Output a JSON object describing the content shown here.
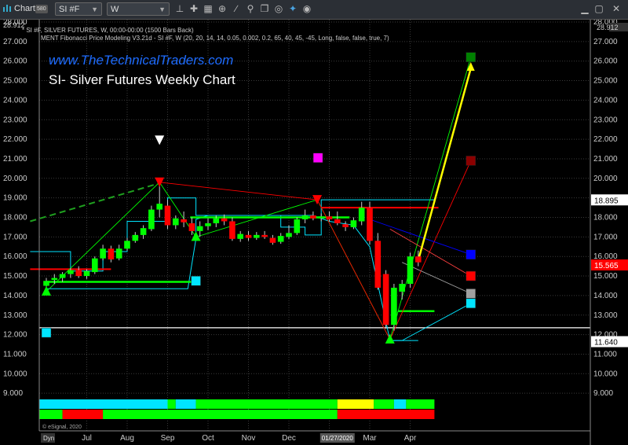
{
  "toolbar": {
    "app_label": "Chart",
    "app_badge": "580",
    "symbol": "SI #F",
    "interval": "W",
    "icons": [
      "pin-icon",
      "crosshair-icon",
      "grid-icon",
      "zoom-icon",
      "trend-icon",
      "link-icon",
      "copy-icon",
      "globe-icon",
      "twitter-icon",
      "eye-icon"
    ]
  },
  "header": {
    "line1": "* SI #F, SILVER FUTURES, W, 00:00-00:00 (1500 Bars Back)",
    "line2": "MENT Fibonacci Price Modeling V3.21d - SI #F, W (20, 20, 14, 14, 0.05, 0.002, 0.2, 65, 40, 45, -45, Long, false, false, true, 7)",
    "corner_left": "28.912",
    "corner_right": "28.912"
  },
  "overlay": {
    "website": "www.TheTechnicalTraders.com",
    "title": "SI- Silver Futures Weekly Chart"
  },
  "footer": {
    "copyright": "© eSignal, 2020",
    "dyn": "Dyn"
  },
  "colors": {
    "up": "#00ff00",
    "down": "#ff0000",
    "cyan": "#00e5ff",
    "yellow": "#ffff00",
    "blue": "#0000ff",
    "magenta": "#ff00ff",
    "green_target": "#008000",
    "darkred_target": "#8b0000",
    "gray": "#a0a0a0",
    "white": "#ffffff",
    "grid": "#3a3a3a",
    "axis_text": "#cccccc"
  },
  "chart_data": {
    "type": "candlestick",
    "ylim": [
      8.5,
      29.1
    ],
    "y_ticks": [
      "9.000",
      "10.000",
      "11.000",
      "12.000",
      "13.000",
      "14.000",
      "15.000",
      "16.000",
      "17.000",
      "18.000",
      "19.000",
      "20.000",
      "21.000",
      "22.000",
      "23.000",
      "24.000",
      "25.000",
      "26.000",
      "27.000",
      "28.000"
    ],
    "x_labels": [
      "Jul",
      "Aug",
      "Sep",
      "Oct",
      "Nov",
      "Dec",
      "2020",
      "Mar",
      "Apr"
    ],
    "x_label_weeks": [
      5,
      10,
      15,
      20,
      25,
      30,
      35,
      40,
      45
    ],
    "x_current_date": "01/27/2020",
    "price_labels": [
      {
        "value": 18.895,
        "text": "18.895",
        "color": "#ffffff",
        "text_color": "#000000"
      },
      {
        "value": 15.565,
        "text": "15.565",
        "color": "#ff0000",
        "text_color": "#ffffff"
      },
      {
        "value": 11.64,
        "text": "11.640",
        "color": "#ffffff",
        "text_color": "#000000"
      }
    ],
    "candles": [
      {
        "o": 14.5,
        "h": 14.9,
        "l": 14.2,
        "c": 14.75
      },
      {
        "o": 14.8,
        "h": 15.1,
        "l": 14.6,
        "c": 14.9
      },
      {
        "o": 14.9,
        "h": 15.2,
        "l": 14.7,
        "c": 15.1
      },
      {
        "o": 15.1,
        "h": 15.4,
        "l": 14.9,
        "c": 15.3
      },
      {
        "o": 15.3,
        "h": 15.5,
        "l": 14.9,
        "c": 15.0
      },
      {
        "o": 15.0,
        "h": 15.35,
        "l": 14.85,
        "c": 15.25
      },
      {
        "o": 15.2,
        "h": 16.0,
        "l": 15.1,
        "c": 15.9
      },
      {
        "o": 15.9,
        "h": 16.6,
        "l": 15.8,
        "c": 16.4
      },
      {
        "o": 16.4,
        "h": 16.55,
        "l": 15.7,
        "c": 15.85
      },
      {
        "o": 15.9,
        "h": 16.6,
        "l": 15.8,
        "c": 16.4
      },
      {
        "o": 16.4,
        "h": 16.95,
        "l": 16.3,
        "c": 16.8
      },
      {
        "o": 16.8,
        "h": 17.25,
        "l": 16.7,
        "c": 17.1
      },
      {
        "o": 17.1,
        "h": 17.6,
        "l": 16.9,
        "c": 17.45
      },
      {
        "o": 17.4,
        "h": 18.6,
        "l": 17.3,
        "c": 18.4
      },
      {
        "o": 18.4,
        "h": 19.8,
        "l": 18.0,
        "c": 18.7
      },
      {
        "o": 18.6,
        "h": 18.9,
        "l": 17.4,
        "c": 17.6
      },
      {
        "o": 17.6,
        "h": 18.1,
        "l": 17.4,
        "c": 17.95
      },
      {
        "o": 17.9,
        "h": 18.3,
        "l": 17.5,
        "c": 17.75
      },
      {
        "o": 17.7,
        "h": 18.0,
        "l": 17.1,
        "c": 17.3
      },
      {
        "o": 17.3,
        "h": 17.8,
        "l": 17.0,
        "c": 17.55
      },
      {
        "o": 17.55,
        "h": 17.95,
        "l": 17.35,
        "c": 17.7
      },
      {
        "o": 17.7,
        "h": 18.1,
        "l": 17.5,
        "c": 17.95
      },
      {
        "o": 17.95,
        "h": 18.15,
        "l": 17.6,
        "c": 17.8
      },
      {
        "o": 17.8,
        "h": 18.0,
        "l": 16.8,
        "c": 16.9
      },
      {
        "o": 16.9,
        "h": 17.3,
        "l": 16.75,
        "c": 17.15
      },
      {
        "o": 17.1,
        "h": 17.3,
        "l": 16.8,
        "c": 16.95
      },
      {
        "o": 16.95,
        "h": 17.25,
        "l": 16.85,
        "c": 17.1
      },
      {
        "o": 17.1,
        "h": 17.3,
        "l": 16.9,
        "c": 17.0
      },
      {
        "o": 16.95,
        "h": 17.1,
        "l": 16.6,
        "c": 16.7
      },
      {
        "o": 16.75,
        "h": 17.2,
        "l": 16.65,
        "c": 17.05
      },
      {
        "o": 17.0,
        "h": 17.6,
        "l": 16.9,
        "c": 17.2
      },
      {
        "o": 17.2,
        "h": 18.0,
        "l": 17.1,
        "c": 17.9
      },
      {
        "o": 17.9,
        "h": 18.4,
        "l": 17.7,
        "c": 18.1
      },
      {
        "o": 18.1,
        "h": 18.3,
        "l": 17.85,
        "c": 17.95
      },
      {
        "o": 17.95,
        "h": 18.2,
        "l": 17.8,
        "c": 18.05
      },
      {
        "o": 18.05,
        "h": 18.3,
        "l": 17.8,
        "c": 17.9
      },
      {
        "o": 17.9,
        "h": 18.3,
        "l": 17.6,
        "c": 17.7
      },
      {
        "o": 17.65,
        "h": 17.8,
        "l": 17.3,
        "c": 17.5
      },
      {
        "o": 17.5,
        "h": 18.0,
        "l": 17.4,
        "c": 17.85
      },
      {
        "o": 17.8,
        "h": 18.8,
        "l": 17.6,
        "c": 18.5
      },
      {
        "o": 18.5,
        "h": 18.8,
        "l": 16.6,
        "c": 16.8
      },
      {
        "o": 16.8,
        "h": 17.2,
        "l": 14.3,
        "c": 14.4
      },
      {
        "o": 15.1,
        "h": 15.3,
        "l": 12.3,
        "c": 12.5
      },
      {
        "o": 12.5,
        "h": 14.6,
        "l": 12.2,
        "c": 14.4
      },
      {
        "o": 14.2,
        "h": 14.8,
        "l": 13.8,
        "c": 14.6
      },
      {
        "o": 14.6,
        "h": 16.2,
        "l": 14.4,
        "c": 16.0
      },
      {
        "o": 16.0,
        "h": 16.3,
        "l": 15.5,
        "c": 15.7
      }
    ],
    "markers": [
      {
        "type": "triangle-up",
        "week": 0,
        "value": 14.2,
        "color": "#00ff00"
      },
      {
        "type": "triangle-down",
        "week": 14,
        "value": 19.8,
        "color": "#ff0000"
      },
      {
        "type": "triangle-down-hollow",
        "week": 14,
        "value": 21.95,
        "color": "#ffffff"
      },
      {
        "type": "triangle-up",
        "week": 18.5,
        "value": 17.0,
        "color": "#00ff00"
      },
      {
        "type": "triangle-down",
        "week": 33.5,
        "value": 18.9,
        "color": "#ff0000"
      },
      {
        "type": "triangle-up",
        "week": 42.5,
        "value": 11.75,
        "color": "#00ff00"
      },
      {
        "type": "square",
        "week": 33.6,
        "value": 21.05,
        "color": "#ff00ff"
      },
      {
        "type": "square",
        "week": 18.5,
        "value": 14.75,
        "color": "#00e5ff"
      },
      {
        "type": "square",
        "week": 0,
        "value": 12.1,
        "color": "#00e5ff"
      },
      {
        "type": "square",
        "week": 52.5,
        "value": 26.2,
        "color": "#008000"
      },
      {
        "type": "square",
        "week": 52.5,
        "value": 20.9,
        "color": "#8b0000"
      },
      {
        "type": "square",
        "week": 52.5,
        "value": 16.1,
        "color": "#0000ff"
      },
      {
        "type": "square",
        "week": 52.5,
        "value": 15.0,
        "color": "#ff0000"
      },
      {
        "type": "square",
        "week": 52.5,
        "value": 14.1,
        "color": "#a0a0a0"
      },
      {
        "type": "square",
        "week": 52.5,
        "value": 13.6,
        "color": "#00e5ff"
      }
    ],
    "cyan_step": [
      [
        -2,
        16.25
      ],
      [
        3,
        16.25
      ],
      [
        3,
        15.25
      ],
      [
        7,
        15.25
      ],
      [
        7,
        16.25
      ],
      [
        10,
        16.25
      ],
      [
        10,
        17.8
      ],
      [
        15,
        17.8
      ],
      [
        15,
        19.0
      ],
      [
        18.5,
        19.0
      ],
      [
        18.5,
        18.1
      ],
      [
        29,
        18.1
      ],
      [
        29,
        17.5
      ],
      [
        32,
        17.5
      ],
      [
        32,
        17.1
      ],
      [
        34,
        17.1
      ],
      [
        34,
        18.9
      ],
      [
        48,
        18.9
      ]
    ],
    "cyan_lower": [
      [
        0,
        14.35
      ],
      [
        17.5,
        14.35
      ],
      [
        17.5,
        14.35
      ],
      [
        18.5,
        16.9
      ],
      [
        18.5,
        17.9
      ],
      [
        20,
        18.1
      ],
      [
        33,
        18.1
      ],
      [
        35,
        17.8
      ],
      [
        38,
        17.6
      ],
      [
        40,
        16.5
      ],
      [
        42.5,
        11.7
      ],
      [
        44,
        11.7
      ]
    ],
    "cyan_tail": [
      [
        42.5,
        11.7
      ],
      [
        46,
        11.7
      ]
    ],
    "green_support_lines": [
      {
        "y": 14.7,
        "x1": 0,
        "x2": 19.0
      },
      {
        "y": 18.0,
        "x1": 17.8,
        "x2": 37.5
      },
      {
        "y": 13.2,
        "x1": 43.5,
        "x2": 48.0
      }
    ],
    "red_res_lines": [
      {
        "y": 18.5,
        "x1": 34,
        "x2": 48.5
      },
      {
        "y": 15.35,
        "x1": -2,
        "x2": 8.0
      }
    ],
    "white_h_line": {
      "y": 12.35
    },
    "dashed_green": [
      [
        -2,
        17.8
      ],
      [
        14,
        19.75
      ]
    ],
    "fib_lines": [
      {
        "color": "#00ff00",
        "pts": [
          [
            0,
            14.2
          ],
          [
            14,
            19.8
          ],
          [
            18.5,
            17.0
          ],
          [
            33.5,
            18.9
          ],
          [
            42.5,
            11.75
          ],
          [
            52.5,
            26.2
          ]
        ]
      },
      {
        "color": "#ff0000",
        "pts": [
          [
            14,
            19.8
          ],
          [
            33.5,
            18.9
          ],
          [
            42.5,
            11.75
          ],
          [
            52.5,
            20.9
          ]
        ]
      },
      {
        "color": "#0000ff",
        "pts": [
          [
            40,
            17.9
          ],
          [
            52.5,
            16.1
          ]
        ]
      },
      {
        "color": "#ff4040",
        "pts": [
          [
            42.5,
            17.4
          ],
          [
            52.5,
            15.0
          ]
        ]
      },
      {
        "color": "#a0a0a0",
        "pts": [
          [
            44,
            15.7
          ],
          [
            52.5,
            14.1
          ]
        ]
      },
      {
        "color": "#00e5ff",
        "pts": [
          [
            44,
            11.7
          ],
          [
            52.5,
            13.6
          ]
        ]
      }
    ],
    "yellow_arrow": {
      "from": [
        46,
        15.8
      ],
      "to": [
        52.5,
        25.95
      ]
    },
    "indicator_row1": [
      {
        "from": -2,
        "to": 15,
        "color": "#00e5ff"
      },
      {
        "from": 15,
        "to": 16,
        "color": "#00ff00"
      },
      {
        "from": 16,
        "to": 18.5,
        "color": "#00e5ff"
      },
      {
        "from": 18.5,
        "to": 36,
        "color": "#00ff00"
      },
      {
        "from": 36,
        "to": 40.5,
        "color": "#ffff00"
      },
      {
        "from": 40.5,
        "to": 43,
        "color": "#00ff00"
      },
      {
        "from": 43,
        "to": 44.5,
        "color": "#00e5ff"
      },
      {
        "from": 44.5,
        "to": 48,
        "color": "#00ff00"
      }
    ],
    "indicator_row2": [
      {
        "from": -2,
        "to": 2,
        "color": "#00ff00"
      },
      {
        "from": 2,
        "to": 7,
        "color": "#ff0000"
      },
      {
        "from": 7,
        "to": 36,
        "color": "#00ff00"
      },
      {
        "from": 36,
        "to": 48,
        "color": "#ff0000"
      }
    ]
  }
}
